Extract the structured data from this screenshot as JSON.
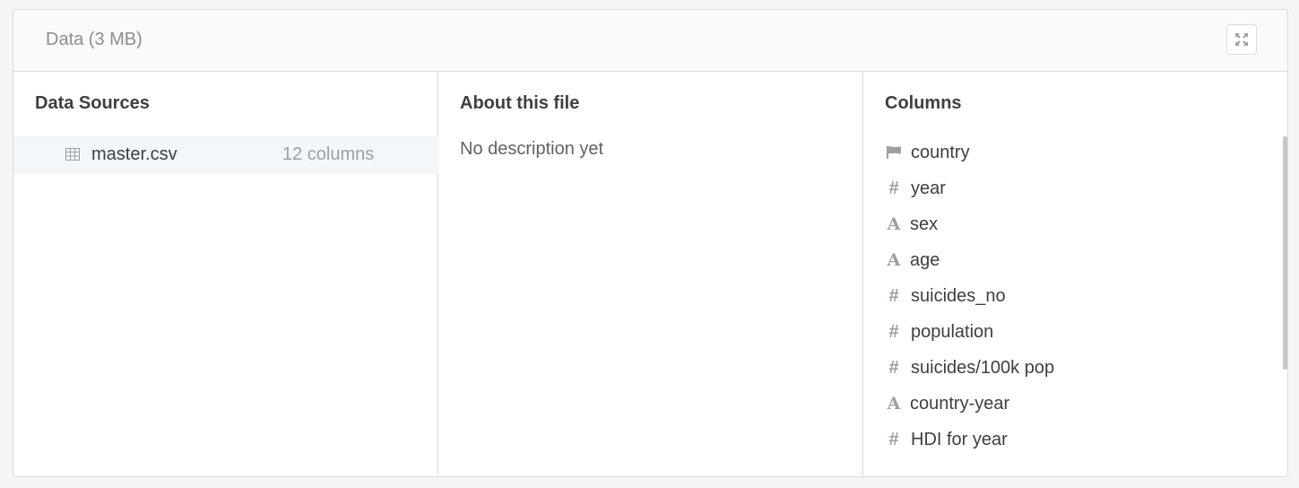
{
  "header": {
    "title": "Data (3 MB)",
    "expand_icon": "expand-icon"
  },
  "sources": {
    "title": "Data Sources",
    "items": [
      {
        "icon": "table-icon",
        "name": "master.csv",
        "count": "12 columns"
      }
    ]
  },
  "about": {
    "title": "About this file",
    "description": "No description yet"
  },
  "columns": {
    "title": "Columns",
    "items": [
      {
        "type": "flag",
        "name": "country"
      },
      {
        "type": "numeric",
        "name": "year"
      },
      {
        "type": "text",
        "name": "sex"
      },
      {
        "type": "text",
        "name": "age"
      },
      {
        "type": "numeric",
        "name": "suicides_no"
      },
      {
        "type": "numeric",
        "name": "population"
      },
      {
        "type": "numeric",
        "name": "suicides/100k pop"
      },
      {
        "type": "text",
        "name": "country-year"
      },
      {
        "type": "numeric",
        "name": "HDI for year"
      }
    ]
  },
  "colors": {
    "accent_icon": "#9aa0a6",
    "selected_row": "#f3f7fa",
    "border": "#dadce0"
  }
}
